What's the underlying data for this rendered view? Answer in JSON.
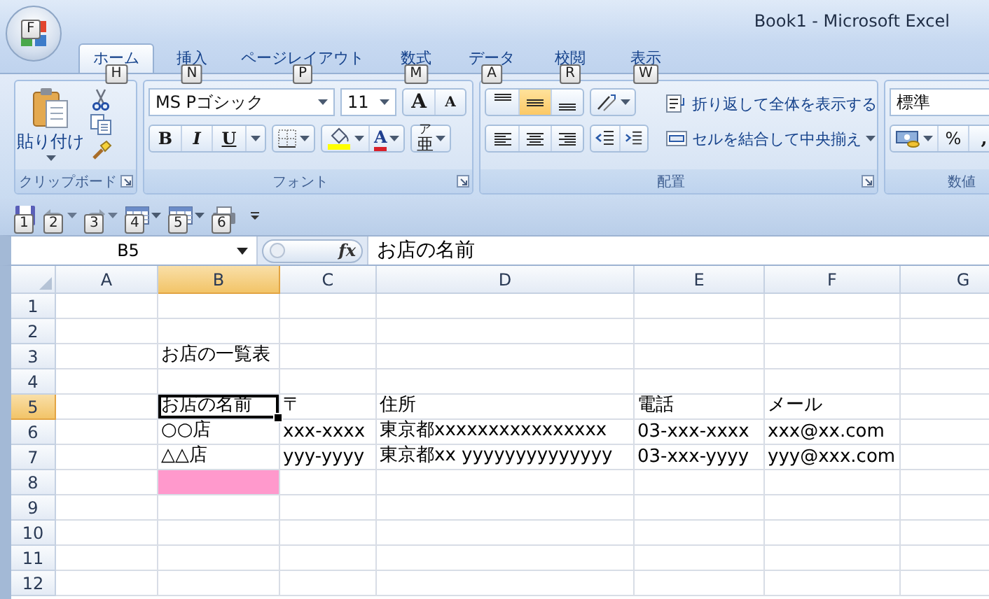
{
  "window": {
    "title": "Book1 - Microsoft Excel",
    "office_button": {
      "keytip": "F"
    }
  },
  "tabs": [
    {
      "label": "ホーム",
      "keytip": "H",
      "selected": true
    },
    {
      "label": "挿入",
      "keytip": "N",
      "selected": false
    },
    {
      "label": "ページレイアウト",
      "keytip": "P",
      "selected": false
    },
    {
      "label": "数式",
      "keytip": "M",
      "selected": false
    },
    {
      "label": "データ",
      "keytip": "A",
      "selected": false
    },
    {
      "label": "校閲",
      "keytip": "R",
      "selected": false
    },
    {
      "label": "表示",
      "keytip": "W",
      "selected": false
    }
  ],
  "ribbon": {
    "clipboard": {
      "title": "クリップボード",
      "paste_label": "貼り付け"
    },
    "font": {
      "title": "フォント",
      "font_name": "MS Pゴシック",
      "font_size": "11",
      "grow_label": "A",
      "shrink_label": "A",
      "bold_label": "B",
      "italic_label": "I",
      "underline_label": "U",
      "font_color_label": "A",
      "phonetic_label": "亜",
      "phonetic_ruby": "ア"
    },
    "alignment": {
      "title": "配置",
      "vertical": [
        {
          "kind": "top",
          "selected": false
        },
        {
          "kind": "middle",
          "selected": true
        },
        {
          "kind": "bottom",
          "selected": false
        }
      ],
      "horizontal": [
        {
          "kind": "left",
          "selected": false
        },
        {
          "kind": "center",
          "selected": false
        },
        {
          "kind": "right",
          "selected": false
        }
      ],
      "wrap_label": "折り返して全体を表示する",
      "merge_label": "セルを結合して中央揃え"
    },
    "number": {
      "title": "数値",
      "format": "標準",
      "percent_label": "%",
      "comma_label": ","
    }
  },
  "quick_access": [
    {
      "kind": "save",
      "keytip": "1",
      "disabled": false
    },
    {
      "kind": "undo",
      "keytip": "2",
      "disabled": true
    },
    {
      "kind": "redo",
      "keytip": "3",
      "disabled": true
    },
    {
      "kind": "table",
      "keytip": "4",
      "disabled": false
    },
    {
      "kind": "table",
      "keytip": "5",
      "disabled": false
    },
    {
      "kind": "printer",
      "keytip": "6",
      "disabled": false
    }
  ],
  "formula_bar": {
    "name_box": "B5",
    "fx_label": "fx",
    "value": "お店の名前"
  },
  "sheet": {
    "columns": [
      {
        "label": "A",
        "selected": false
      },
      {
        "label": "B",
        "selected": true
      },
      {
        "label": "C",
        "selected": false
      },
      {
        "label": "D",
        "selected": false
      },
      {
        "label": "E",
        "selected": false
      },
      {
        "label": "F",
        "selected": false
      },
      {
        "label": "G",
        "selected": false
      }
    ],
    "rows": [
      {
        "number": "1",
        "selected": false
      },
      {
        "number": "2",
        "selected": false
      },
      {
        "number": "3",
        "selected": false,
        "cells": {
          "B": {
            "text": "お店の一覧表",
            "active": false
          }
        }
      },
      {
        "number": "4",
        "selected": false
      },
      {
        "number": "5",
        "selected": true,
        "cells": {
          "B": {
            "text": "お店の名前",
            "active": true
          },
          "C": {
            "text": "〒",
            "active": false
          },
          "D": {
            "text": "住所",
            "active": false
          },
          "E": {
            "text": "電話",
            "active": false
          },
          "F": {
            "text": "メール",
            "active": false
          }
        }
      },
      {
        "number": "6",
        "selected": false,
        "cells": {
          "B": {
            "text": "○○店",
            "active": false
          },
          "C": {
            "text": "xxx-xxxx",
            "active": false
          },
          "D": {
            "text": "東京都xxxxxxxxxxxxxxxx",
            "active": false
          },
          "E": {
            "text": "03-xxx-xxxx",
            "active": false
          },
          "F": {
            "text": "xxx@xx.com",
            "active": false
          }
        }
      },
      {
        "number": "7",
        "selected": false,
        "cells": {
          "B": {
            "text": "△△店",
            "active": false
          },
          "C": {
            "text": "yyy-yyyy",
            "active": false
          },
          "D": {
            "text": "東京都xx yyyyyyyyyyyyyy",
            "active": false
          },
          "E": {
            "text": "03-xxx-yyyy",
            "active": false
          },
          "F": {
            "text": "yyy@xxx.com",
            "active": false
          }
        }
      },
      {
        "number": "8",
        "selected": false,
        "cells": {
          "B": {
            "color": "#ff99cc",
            "active": false
          }
        }
      },
      {
        "number": "9",
        "selected": false
      },
      {
        "number": "10",
        "selected": false
      },
      {
        "number": "11",
        "selected": false
      },
      {
        "number": "12",
        "selected": false
      }
    ]
  }
}
